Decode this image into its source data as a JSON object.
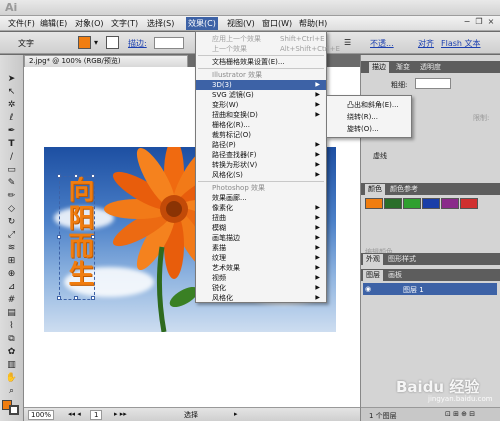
{
  "app": {
    "logo": "Ai"
  },
  "menubar": {
    "items": [
      "文件(F)",
      "编辑(E)",
      "对象(O)",
      "文字(T)",
      "选择(S)",
      "效果(C)",
      "视图(V)",
      "窗口(W)",
      "帮助(H)"
    ],
    "active": "效果(C)"
  },
  "control_bar": {
    "type_label": "文字",
    "stroke_label": "描边:",
    "opacity_label": "不透...",
    "align_label": "对齐",
    "flash_label": "Flash 文本",
    "fill_color": "#f07d10"
  },
  "document": {
    "tab_title": "2.jpg* @ 100% (RGB/预览)",
    "vertical_text": "向阳而生",
    "zoom": "100%",
    "page": "1",
    "status": "选择"
  },
  "effect_menu": {
    "items": [
      {
        "label": "应用上一个效果",
        "shortcut": "Shift+Ctrl+E",
        "disabled": true
      },
      {
        "label": "上一个效果",
        "shortcut": "Alt+Shift+Ctrl+E",
        "disabled": true
      },
      {
        "label": "文档栅格效果设置(E)..."
      },
      {
        "label": "Illustrator 效果",
        "header": true
      },
      {
        "label": "3D(3)",
        "submenu": true,
        "highlighted": true
      },
      {
        "label": "SVG 滤镜(G)",
        "submenu": true
      },
      {
        "label": "变形(W)",
        "submenu": true
      },
      {
        "label": "扭曲和变换(D)",
        "submenu": true
      },
      {
        "label": "栅格化(R)..."
      },
      {
        "label": "裁剪标记(O)"
      },
      {
        "label": "路径(P)",
        "submenu": true
      },
      {
        "label": "路径查找器(F)",
        "submenu": true
      },
      {
        "label": "转换为形状(V)",
        "submenu": true
      },
      {
        "label": "风格化(S)",
        "submenu": true
      },
      {
        "label": "Photoshop 效果",
        "header": true
      },
      {
        "label": "效果画廊..."
      },
      {
        "label": "像素化",
        "submenu": true
      },
      {
        "label": "扭曲",
        "submenu": true
      },
      {
        "label": "模糊",
        "submenu": true
      },
      {
        "label": "画笔描边",
        "submenu": true
      },
      {
        "label": "素描",
        "submenu": true
      },
      {
        "label": "纹理",
        "submenu": true
      },
      {
        "label": "艺术效果",
        "submenu": true
      },
      {
        "label": "视频",
        "submenu": true
      },
      {
        "label": "锐化",
        "submenu": true
      },
      {
        "label": "风格化",
        "submenu": true
      }
    ]
  },
  "submenu_3d": {
    "items": [
      "凸出和斜角(E)...",
      "绕转(R)...",
      "旋转(O)..."
    ],
    "highlighted": "凸出和斜角(E)..."
  },
  "panels": {
    "stroke_tabs": [
      "描边",
      "渐变",
      "透明度"
    ],
    "weight_label": "粗细:",
    "dashed_label": "虚线",
    "offset_label": "限制:",
    "color_tabs": [
      "颜色",
      "颜色参考"
    ],
    "appearance_tabs": [
      "外观",
      "图形样式"
    ],
    "layers_tabs": [
      "图层",
      "画板"
    ],
    "layer_name": "图层 1",
    "layers_count": "1 个图层",
    "edit_colors_label": "编辑颜色",
    "swatch_colors": [
      "#f07d10",
      "#2a6e2a",
      "#30a030",
      "#1a3ea8",
      "#8a2a8a",
      "#d03030"
    ]
  },
  "watermark": {
    "text": "Baidu 经验",
    "sub": "jingyan.baidu.com"
  }
}
